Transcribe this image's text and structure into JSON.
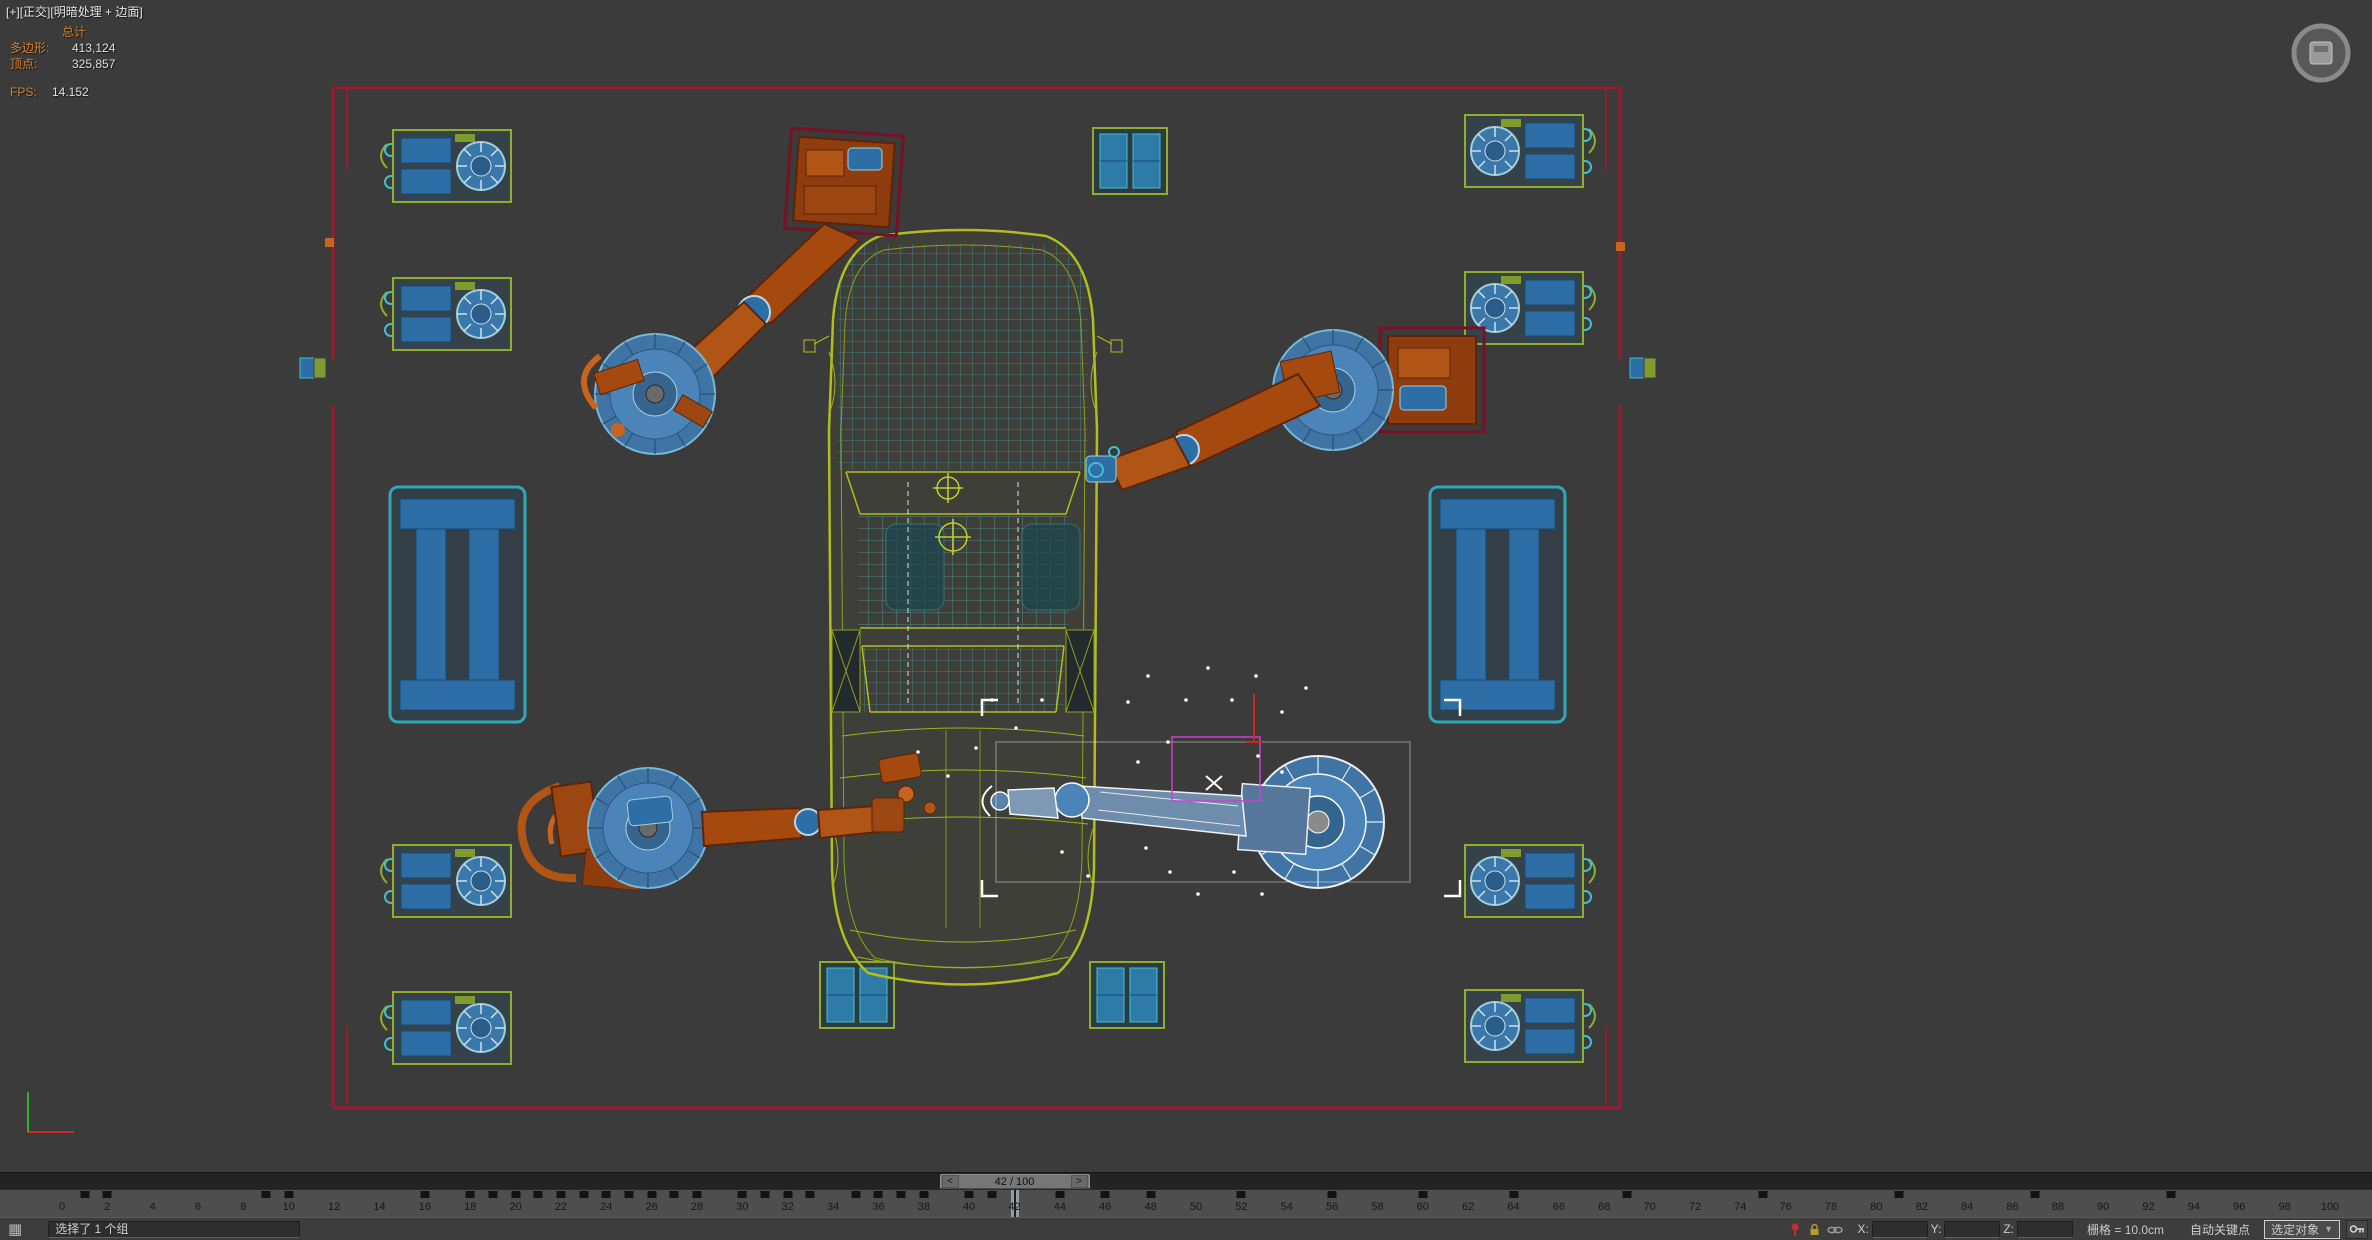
{
  "viewport": {
    "menus": {
      "general": "[+]",
      "pov": "[正交]",
      "shading": "[明暗处理 + 边面]"
    },
    "stats": {
      "total_label": "总计",
      "rows": [
        {
          "label": "多边形:",
          "value": "413,124"
        },
        {
          "label": "顶点:",
          "value": "325,857"
        }
      ],
      "fps_label": "FPS:",
      "fps_value": "14.152"
    }
  },
  "timeline": {
    "start": 0,
    "end": 100,
    "current": 42,
    "display": "42 / 100",
    "prev_label": "<",
    "next_label": ">",
    "label_step": 2,
    "keys": [
      1,
      2,
      9,
      10,
      16,
      18,
      19,
      20,
      21,
      22,
      23,
      24,
      25,
      26,
      27,
      28,
      30,
      31,
      32,
      33,
      35,
      36,
      37,
      38,
      40,
      41,
      44,
      46,
      48,
      52,
      56,
      60,
      64,
      69,
      75,
      81,
      87,
      93
    ]
  },
  "statusbar": {
    "selection_text": "选择了 1 个组",
    "coord": {
      "x_label": "X:",
      "y_label": "Y:",
      "z_label": "Z:",
      "x_value": "",
      "y_value": "",
      "z_value": ""
    },
    "grid_text": "栅格 = 10.0cm",
    "autokey_label": "自动关键点",
    "selection_set_label": "选定对象",
    "grid_icon": "▦"
  },
  "colors": {
    "viewport_bg": "#3b3b3b",
    "car_wireframe": "#aebf1e",
    "robot_orange": "#a5490f",
    "machine_blue": "#2d6ea6",
    "teal_accent": "#3fc0cf",
    "perimeter_red": "#9b1a2e",
    "selection_white": "#ffffff",
    "stats_orange": "#cd8032",
    "helper_magenta": "#cf3fcf"
  }
}
